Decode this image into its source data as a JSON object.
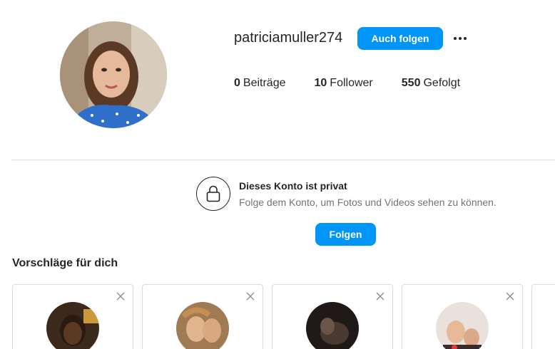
{
  "profile": {
    "username": "patriciamuller274",
    "follow_back_label": "Auch folgen",
    "stats": [
      {
        "value": "0",
        "label": "Beiträge"
      },
      {
        "value": "10",
        "label": "Follower"
      },
      {
        "value": "550",
        "label": "Gefolgt"
      }
    ]
  },
  "private": {
    "title": "Dieses Konto ist privat",
    "subtitle": "Folge dem Konto, um Fotos und Videos sehen zu können.",
    "follow_label": "Folgen"
  },
  "suggestions": {
    "title": "Vorschläge für dich"
  },
  "colors": {
    "accent": "#0095f6",
    "border": "#dbdbdb",
    "text": "#262626",
    "muted": "#737373"
  },
  "icons": [
    "more-icon",
    "lock-icon",
    "close-icon"
  ]
}
